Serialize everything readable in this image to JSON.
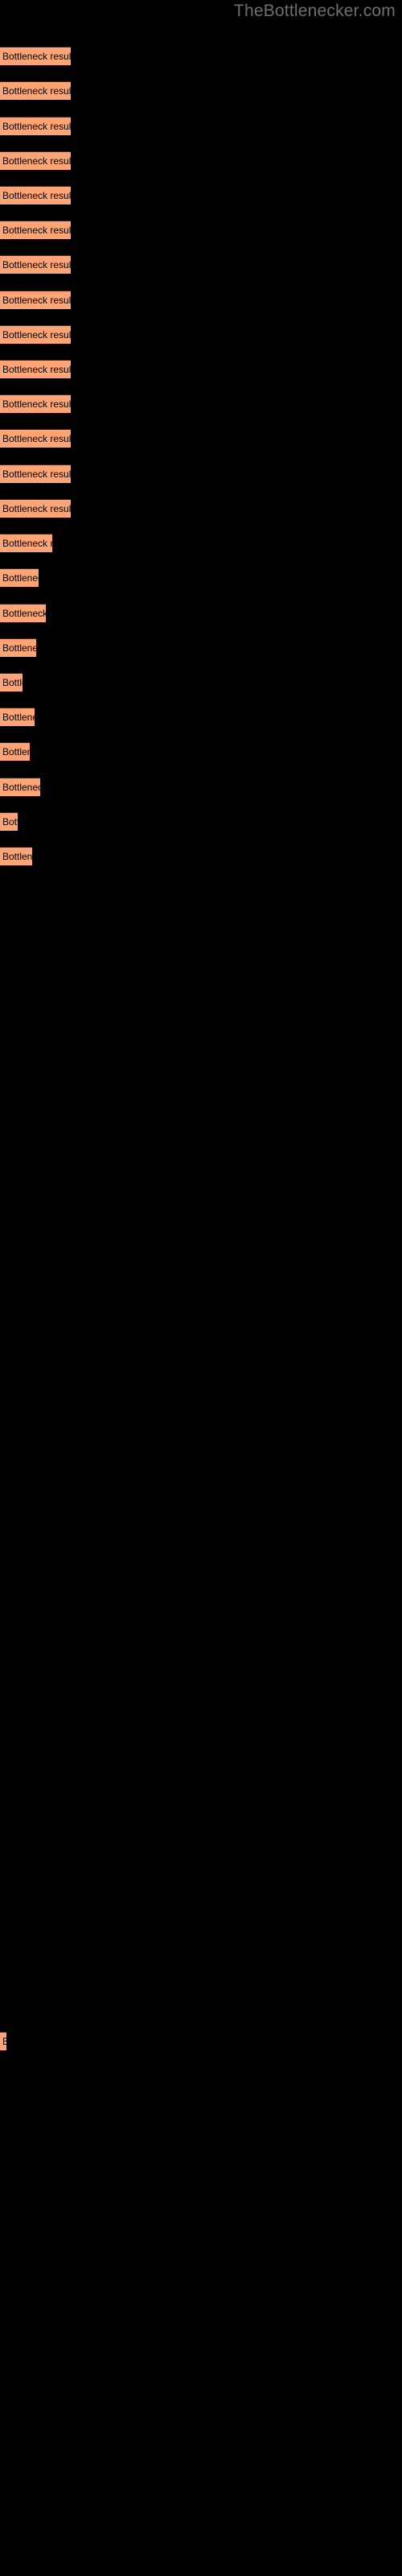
{
  "site": {
    "title": "TheBottlenecker.com",
    "title_color": "#6e6e6e"
  },
  "colors": {
    "background": "#000000",
    "bar_fill": "#ffa474",
    "bar_border": "#3d2b1f",
    "label_text": "#000000"
  },
  "chart_data": {
    "type": "bar",
    "orientation": "horizontal",
    "title": "",
    "xlabel": "",
    "ylabel": "",
    "grid": false,
    "legend": false,
    "bar_label_text": "Bottleneck result",
    "categories": [
      "Bottleneck result",
      "Bottleneck result",
      "Bottleneck result",
      "Bottleneck result",
      "Bottleneck result",
      "Bottleneck result",
      "Bottleneck result",
      "Bottleneck result",
      "Bottleneck result",
      "Bottleneck result",
      "Bottleneck result",
      "Bottleneck result",
      "Bottleneck result",
      "Bottleneck result",
      "Bottleneck result",
      "Bottleneck result",
      "Bottleneck result",
      "Bottleneck result",
      "Bottleneck result",
      "Bottleneck result",
      "Bottleneck result",
      "Bottleneck result",
      "Bottleneck result",
      "Bottleneck result",
      "Bottleneck result"
    ],
    "values": [
      88,
      88,
      88,
      88,
      88,
      88,
      88,
      88,
      88,
      88,
      88,
      88,
      88,
      65,
      50,
      57,
      45,
      28,
      42,
      37,
      50,
      22,
      40,
      0,
      8
    ],
    "xlim": [
      0,
      500
    ],
    "bars": [
      {
        "index": 1,
        "y": 58,
        "width": 88,
        "label": "Bottleneck result"
      },
      {
        "index": 2,
        "y": 101,
        "width": 88,
        "label": "Bottleneck result"
      },
      {
        "index": 3,
        "y": 145,
        "width": 88,
        "label": "Bottleneck result"
      },
      {
        "index": 4,
        "y": 188,
        "width": 88,
        "label": "Bottleneck result"
      },
      {
        "index": 5,
        "y": 231,
        "width": 88,
        "label": "Bottleneck result"
      },
      {
        "index": 6,
        "y": 274,
        "width": 88,
        "label": "Bottleneck result"
      },
      {
        "index": 7,
        "y": 317,
        "width": 88,
        "label": "Bottleneck result"
      },
      {
        "index": 8,
        "y": 361,
        "width": 88,
        "label": "Bottleneck result"
      },
      {
        "index": 9,
        "y": 404,
        "width": 88,
        "label": "Bottleneck result"
      },
      {
        "index": 10,
        "y": 447,
        "width": 88,
        "label": "Bottleneck result"
      },
      {
        "index": 11,
        "y": 490,
        "width": 88,
        "label": "Bottleneck result"
      },
      {
        "index": 12,
        "y": 533,
        "width": 88,
        "label": "Bottleneck result"
      },
      {
        "index": 13,
        "y": 577,
        "width": 88,
        "label": "Bottleneck result"
      },
      {
        "index": 14,
        "y": 620,
        "width": 88,
        "label": "Bottleneck result"
      },
      {
        "index": 15,
        "y": 663,
        "width": 65,
        "label": "Bottleneck result"
      },
      {
        "index": 16,
        "y": 706,
        "width": 48,
        "label": "Bottleneck result"
      },
      {
        "index": 17,
        "y": 750,
        "width": 57,
        "label": "Bottleneck result"
      },
      {
        "index": 18,
        "y": 793,
        "width": 45,
        "label": "Bottleneck result"
      },
      {
        "index": 19,
        "y": 836,
        "width": 28,
        "label": "Bottleneck result"
      },
      {
        "index": 20,
        "y": 879,
        "width": 43,
        "label": "Bottleneck result"
      },
      {
        "index": 21,
        "y": 922,
        "width": 37,
        "label": "Bottleneck result"
      },
      {
        "index": 22,
        "y": 966,
        "width": 50,
        "label": "Bottleneck result"
      },
      {
        "index": 23,
        "y": 1009,
        "width": 22,
        "label": "Bottleneck result"
      },
      {
        "index": 24,
        "y": 1052,
        "width": 40,
        "label": "Bottleneck result"
      },
      {
        "index": 25,
        "y": 2524,
        "width": 8,
        "label": "Bottleneck result"
      }
    ]
  }
}
